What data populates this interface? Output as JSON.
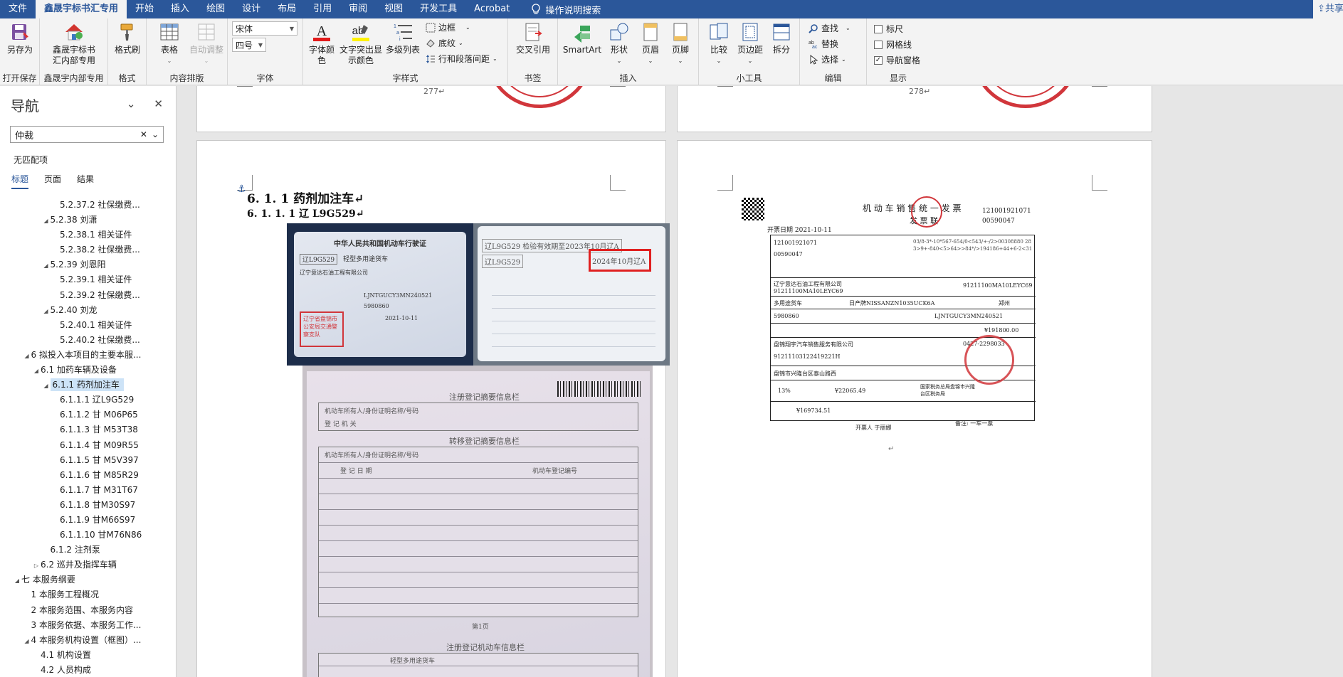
{
  "menu": {
    "tabs": [
      "文件",
      "鑫晟宇标书汇专用",
      "开始",
      "插入",
      "绘图",
      "设计",
      "布局",
      "引用",
      "审阅",
      "视图",
      "开发工具",
      "Acrobat"
    ],
    "active_index": 1,
    "tell_me": "操作说明搜索",
    "share": "共享"
  },
  "ribbon": {
    "saveas": "另存为",
    "group_save": "打开保存",
    "xsy_btn": "鑫晟宇标书\n汇内部专用",
    "group_xsy": "鑫晟宇内部专用",
    "format_painter": "格式刷",
    "group_format": "格式",
    "table": "表格",
    "autofit": "自动调整",
    "group_layout": "内容排版",
    "font_name": "宋体",
    "font_size": "四号",
    "group_font": "字体",
    "font_color": "字体颜\n色",
    "highlight": "文字突出显\n示颜色",
    "multilevel": "多级列表",
    "borders": "边框",
    "shading": "底纹",
    "line_spacing": "行和段落间距",
    "group_style": "字样式",
    "cross_ref": "交叉引用",
    "group_bookmark": "书签",
    "smartart": "SmartArt",
    "shapes": "形状",
    "header": "页眉",
    "footer": "页脚",
    "group_insert": "插入",
    "compare": "比较",
    "margins": "页边距",
    "split": "拆分",
    "group_tools": "小工具",
    "find": "查找",
    "replace": "替换",
    "select": "选择",
    "group_edit": "编辑",
    "ruler": "标尺",
    "gridlines": "网格线",
    "nav_pane": "导航窗格",
    "ruler_checked": false,
    "gridlines_checked": false,
    "nav_pane_checked": true,
    "group_show": "显示"
  },
  "nav": {
    "title": "导航",
    "search_value": "仲裁",
    "no_match": "无匹配项",
    "tabs": [
      "标题",
      "页面",
      "结果"
    ],
    "tree": [
      {
        "level": 4,
        "twisty": "",
        "label": "5.2.37.2 社保缴费..."
      },
      {
        "level": 3,
        "twisty": "◢",
        "label": "5.2.38 刘潇"
      },
      {
        "level": 4,
        "twisty": "",
        "label": "5.2.38.1 相关证件"
      },
      {
        "level": 4,
        "twisty": "",
        "label": "5.2.38.2 社保缴费..."
      },
      {
        "level": 3,
        "twisty": "◢",
        "label": "5.2.39 刘恩阳"
      },
      {
        "level": 4,
        "twisty": "",
        "label": "5.2.39.1 相关证件"
      },
      {
        "level": 4,
        "twisty": "",
        "label": "5.2.39.2 社保缴费..."
      },
      {
        "level": 3,
        "twisty": "◢",
        "label": "5.2.40 刘龙"
      },
      {
        "level": 4,
        "twisty": "",
        "label": "5.2.40.1 相关证件"
      },
      {
        "level": 4,
        "twisty": "",
        "label": "5.2.40.2 社保缴费..."
      },
      {
        "level": 1,
        "twisty": "◢",
        "label": "6 拟投入本项目的主要本服..."
      },
      {
        "level": 2,
        "twisty": "◢",
        "label": "6.1 加药车辆及设备"
      },
      {
        "level": 3,
        "twisty": "◢",
        "label": "6.1.1 药剂加注车",
        "selected": true
      },
      {
        "level": 4,
        "twisty": "",
        "label": "6.1.1.1 辽L9G529"
      },
      {
        "level": 4,
        "twisty": "",
        "label": "6.1.1.2 甘 M06P65"
      },
      {
        "level": 4,
        "twisty": "",
        "label": "6.1.1.3 甘 M53T38"
      },
      {
        "level": 4,
        "twisty": "",
        "label": "6.1.1.4 甘 M09R55"
      },
      {
        "level": 4,
        "twisty": "",
        "label": "6.1.1.5 甘 M5V397"
      },
      {
        "level": 4,
        "twisty": "",
        "label": "6.1.1.6 甘 M85R29"
      },
      {
        "level": 4,
        "twisty": "",
        "label": "6.1.1.7 甘 M31T67"
      },
      {
        "level": 4,
        "twisty": "",
        "label": "6.1.1.8 甘M30S97"
      },
      {
        "level": 4,
        "twisty": "",
        "label": "6.1.1.9 甘M66S97"
      },
      {
        "level": 4,
        "twisty": "",
        "label": "6.1.1.10 甘M76N86"
      },
      {
        "level": 3,
        "twisty": "",
        "label": "6.1.2 注剂泵"
      },
      {
        "level": 2,
        "twisty": "▷",
        "label": "6.2 巡井及指挥车辆"
      },
      {
        "level": 0,
        "twisty": "◢",
        "label": "七 本服务纲要"
      },
      {
        "level": 1,
        "twisty": "",
        "label": "1 本服务工程概况"
      },
      {
        "level": 1,
        "twisty": "",
        "label": "2 本服务范围、本服务内容"
      },
      {
        "level": 1,
        "twisty": "",
        "label": "3 本服务依据、本服务工作..."
      },
      {
        "level": 1,
        "twisty": "◢",
        "label": "4 本服务机构设置（框图）..."
      },
      {
        "level": 2,
        "twisty": "",
        "label": "4.1 机构设置"
      },
      {
        "level": 2,
        "twisty": "",
        "label": "4.2 人员构成"
      }
    ]
  },
  "document": {
    "page_277": "277↵",
    "page_278": "278↵",
    "heading_1": "6. 1. 1  药剂加注车↵",
    "heading_2": "6. 1. 1. 1  辽 L9G529↵",
    "license_title": "中华人民共和国机动车行驶证",
    "license_plate": "辽L9G529",
    "license_type": "轻型多用途货车",
    "license_owner": "辽宁意达石油工程有限公司",
    "license_vin": "LJNTGUCY3MN240521",
    "license_engine": "5980860",
    "license_date": "2021-10-11",
    "license_seal": "辽宁省盘锦市公安局交通警察支队",
    "inspection_text": "辽L9G529 检验有效期至2023年10月辽A",
    "inspection_highlight": "2024年10月辽A",
    "reg_title": "注册登记摘要信息栏",
    "reg_transfer": "转移登记摘要信息栏",
    "reg_page": "第1页",
    "reg_title2": "注册登记机动车信息栏",
    "reg_row_label": "机动车所有人/身份证明名称/号码",
    "reg_date_label": "登 记 日 期",
    "reg_no_label": "机动车登记编号",
    "reg_org": "登 记 机 关",
    "invoice_title": "机 动 车 销 售 统 一 发 票",
    "invoice_sub": "发  票  联",
    "invoice_date": "开票日期  2021-10-11",
    "invoice_code": "121001921071",
    "invoice_no": "00590047",
    "buyer": "辽宁意达石油工程有限公司",
    "buyer_id": "91211100MA10LEYC69",
    "vehicle_type": "多用途货车",
    "brand": "日产牌NISSANZN1035UCK6A",
    "origin": "郑州",
    "vin": "LJNTGUCY3MN240521",
    "engine": "5980860",
    "price_small": "¥191800.00",
    "seller": "盘锦翔宇汽车销售服务有限公司",
    "seller_phone": "0427-2298033",
    "seller_id": "91211103122419221H",
    "address": "盘锦市兴隆台区泰山路西",
    "tax_rate": "13%",
    "tax": "¥22065.49",
    "no_tax_price": "¥169734.51",
    "tax_office": "国家税务总局盘锦市兴隆台区税务局",
    "drawer": "开票人  于丽娜",
    "remark": "备注: 一车一票"
  },
  "colors": {
    "brand_blue": "#2b579a",
    "stamp_red": "#d1363b",
    "highlight_box": "#e02020"
  }
}
